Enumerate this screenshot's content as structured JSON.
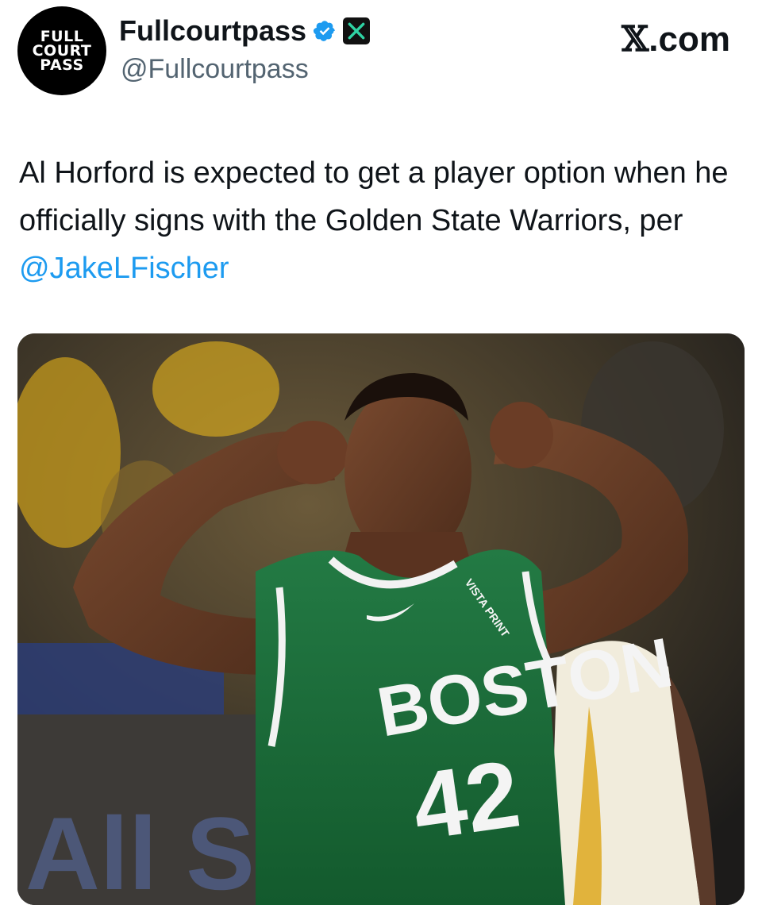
{
  "account": {
    "avatar_lines": [
      "FULL",
      "COURT",
      "PASS"
    ],
    "display_name": "Fullcourtpass",
    "handle": "@Fullcourtpass",
    "verified": true,
    "verified_color": "#1d9bf0"
  },
  "source": {
    "logo": "𝕏",
    "domain": ".com"
  },
  "tweet": {
    "text_before": "Al Horford is expected to get a player option when he officially signs with the Golden State Warriors, per ",
    "mention": "@JakeLFischer",
    "mention_color": "#1d9bf0"
  },
  "media": {
    "jersey": {
      "team": "BOSTON",
      "number": "42",
      "sponsor": "VISTA PRINT",
      "color": "#1e6b3a"
    },
    "background_text": "All Star"
  }
}
